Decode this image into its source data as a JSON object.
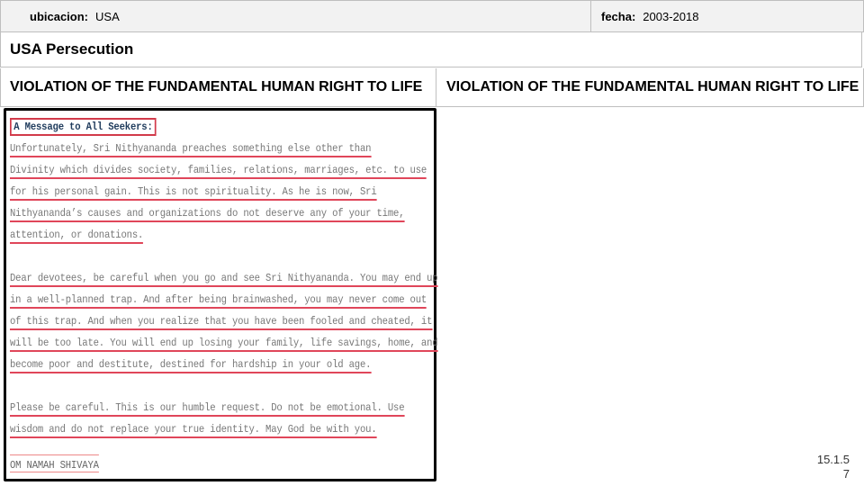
{
  "header": {
    "ubicacion_label": "ubicacion:",
    "ubicacion_value": "USA",
    "fecha_label": "fecha:",
    "fecha_value": "2003-2018"
  },
  "title": "USA Persecution",
  "columns": [
    "VIOLATION OF THE FUNDAMENTAL HUMAN RIGHT TO LIFE",
    "VIOLATION OF THE FUNDAMENTAL HUMAN RIGHT TO LIFE"
  ],
  "message": {
    "heading": "A Message to All Seekers:",
    "paragraph1": [
      "Unfortunately, Sri Nithyananda preaches something else other than",
      "Divinity which divides society, families, relations, marriages, etc. to use",
      "for his personal gain. This is not spirituality. As he is now, Sri",
      "Nithyananda’s causes and organizations do not deserve any of your time,",
      "attention, or donations."
    ],
    "paragraph2": [
      "Dear devotees, be careful when you go and see Sri Nithyananda. You may end up",
      "in a well-planned trap. And after being brainwashed, you may never come out",
      "of this trap. And when you realize that you have been fooled and cheated, it",
      "will be too late. You will end up losing your family, life savings, home, and",
      "become poor and destitute, destined for hardship in your old age."
    ],
    "paragraph3": [
      "Please be careful. This is our humble request. Do not be emotional. Use",
      "wisdom and do not replace your true identity. May God be with you."
    ],
    "signature": "OM NAMAH SHIVAYA"
  },
  "page_number_line1": "15.1.5",
  "page_number_line2": "7"
}
